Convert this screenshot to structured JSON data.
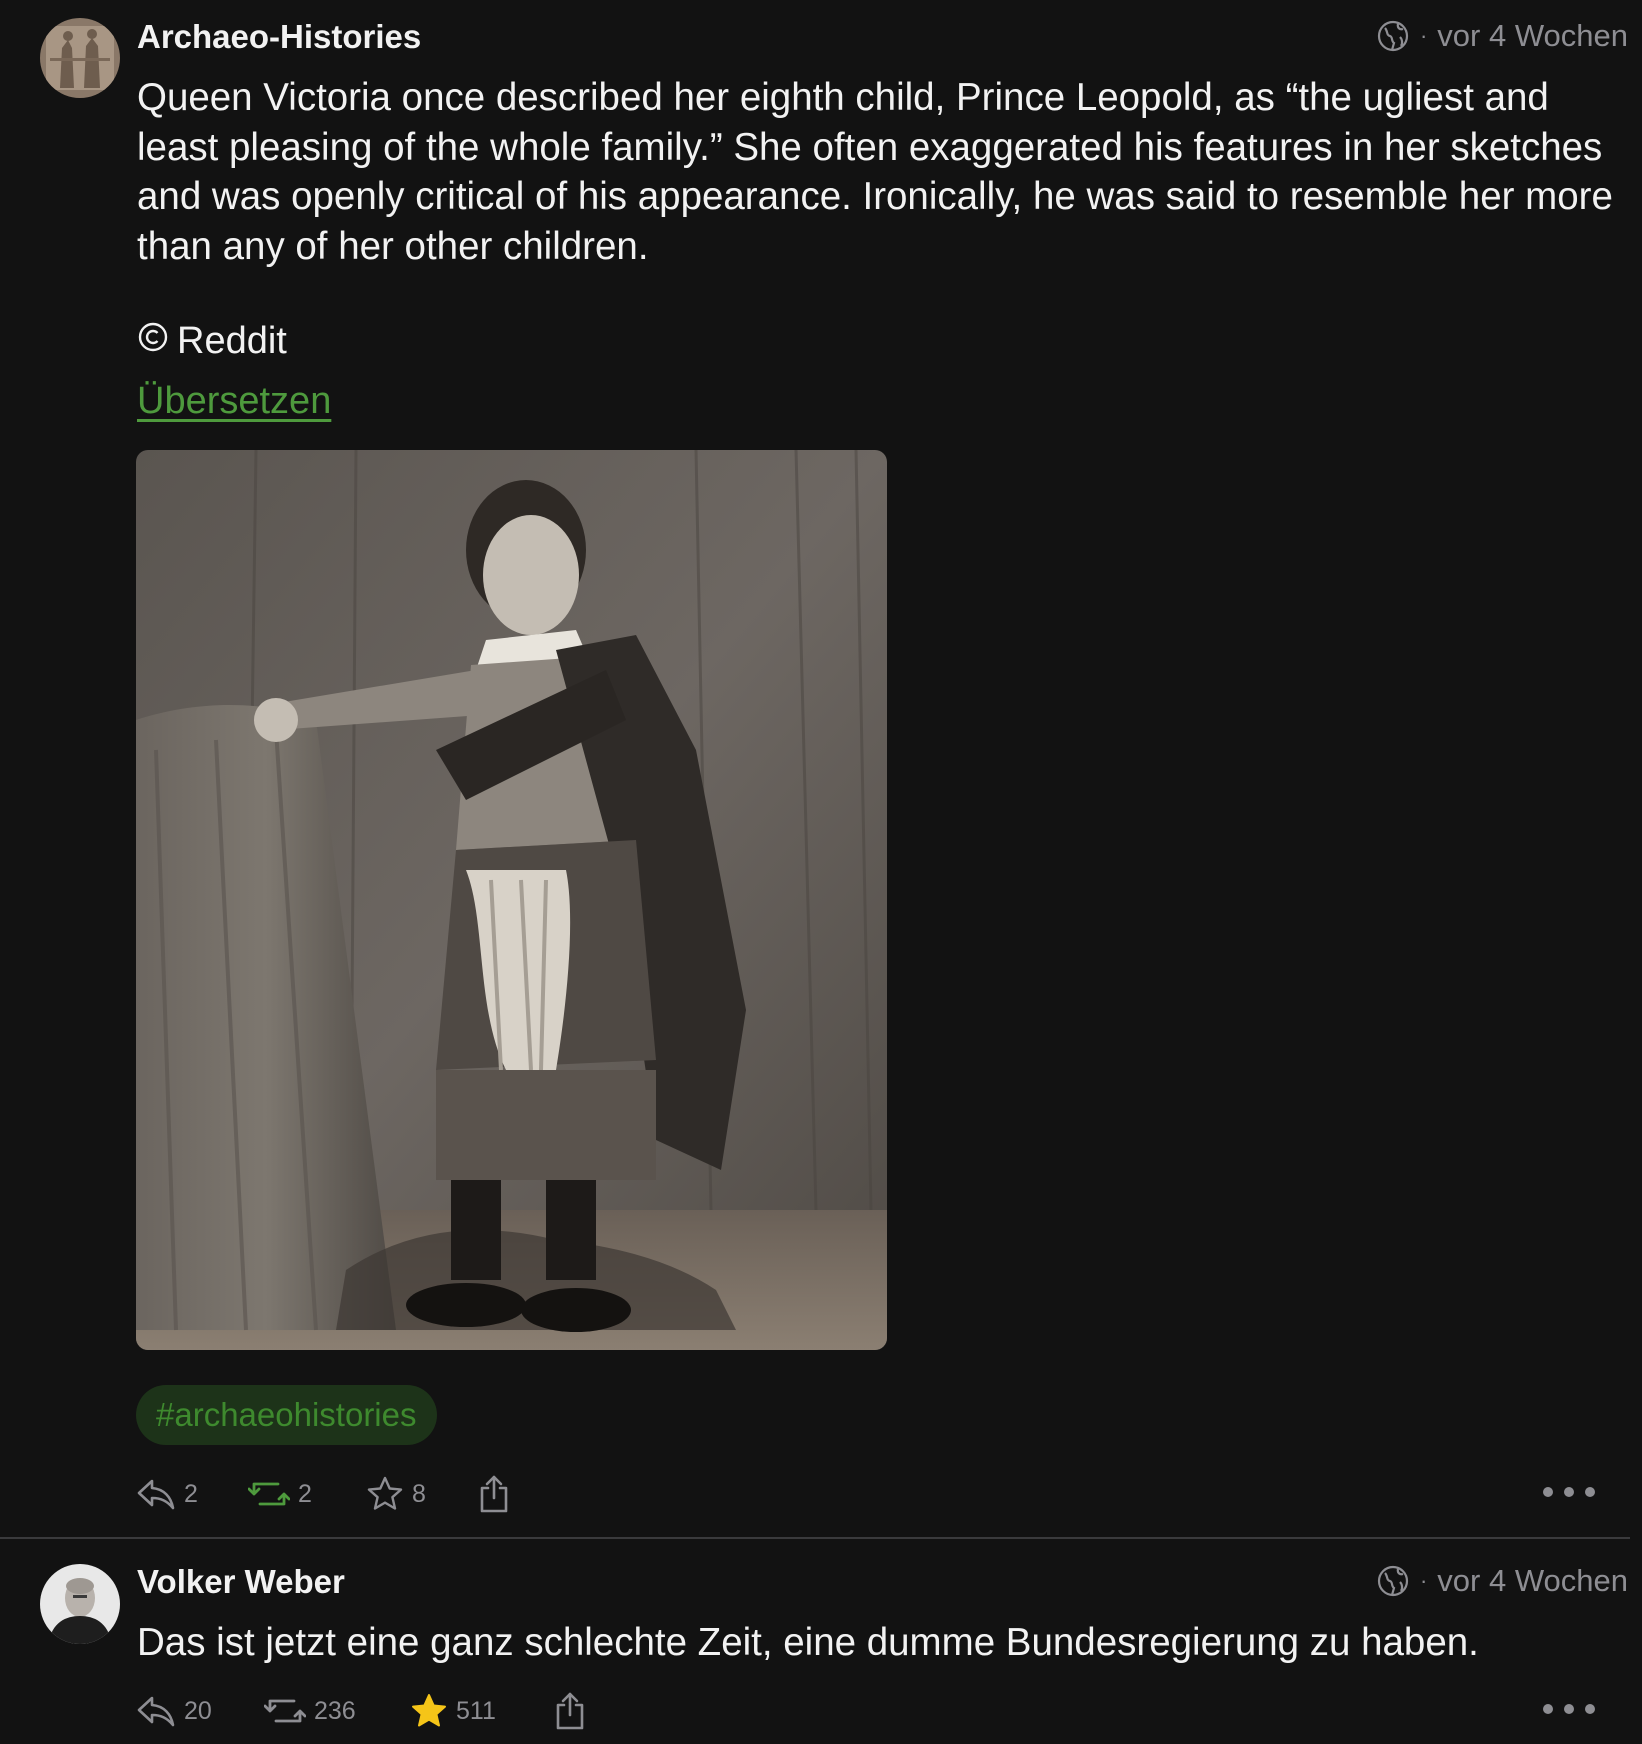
{
  "posts": [
    {
      "author": "Archaeo-Histories",
      "time": "vor 4 Wochen",
      "visibility_icon": "globe-icon",
      "body": "Queen Victoria once described her eighth child, Prince Leopold, as “the ugliest and least pleasing of the whole family.” She often exaggerated his features in her sketches and was openly critical of his appearance. Ironically, he was said to resemble her more than any of her other children.",
      "credit": "Reddit",
      "translate_label": "Übersetzen",
      "hashtag": "#archaeohistories",
      "replies": "2",
      "boosts": "2",
      "favourites": "8"
    },
    {
      "author": "Volker Weber",
      "time": "vor 4 Wochen",
      "visibility_icon": "globe-icon",
      "body": "Das ist jetzt eine ganz schlechte Zeit, eine dumme Bundesregierung zu haben.",
      "replies": "20",
      "boosts": "236",
      "favourites": "511"
    }
  ],
  "colors": {
    "background": "#121212",
    "accent_green": "#4e9a3d",
    "hashtag_bg": "#1d3319",
    "muted": "#8e8e93",
    "star_active": "#f5c518"
  }
}
